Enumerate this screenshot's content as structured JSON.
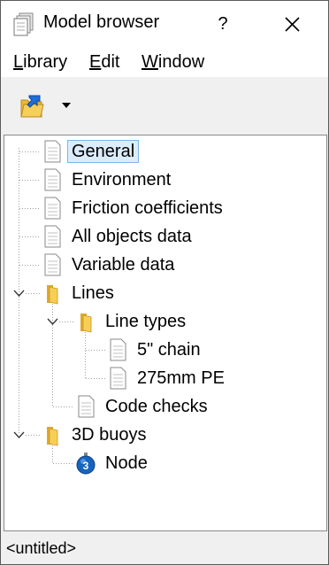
{
  "window": {
    "title": "Model browser",
    "help": "?"
  },
  "menu": [
    {
      "label": "Library",
      "accel": "L",
      "rest": "ibrary"
    },
    {
      "label": "Edit",
      "accel": "E",
      "rest": "dit"
    },
    {
      "label": "Window",
      "accel": "W",
      "rest": "indow"
    }
  ],
  "tree": {
    "items": [
      {
        "label": "General",
        "icon": "document-icon",
        "selected": true
      },
      {
        "label": "Environment",
        "icon": "document-icon"
      },
      {
        "label": "Friction coefficients",
        "icon": "document-icon"
      },
      {
        "label": "All objects data",
        "icon": "document-icon"
      },
      {
        "label": "Variable data",
        "icon": "document-icon"
      },
      {
        "label": "Lines",
        "icon": "folder-icon",
        "expanded": true
      },
      {
        "label": "Line types",
        "icon": "folder-icon",
        "expanded": true
      },
      {
        "label": "5\" chain",
        "icon": "document-icon"
      },
      {
        "label": "275mm PE",
        "icon": "document-icon"
      },
      {
        "label": "Code checks",
        "icon": "document-icon"
      },
      {
        "label": "3D buoys",
        "icon": "folder-icon",
        "expanded": true
      },
      {
        "label": "Node",
        "icon": "buoy-3d-icon",
        "badge": "3"
      }
    ]
  },
  "status": {
    "text": "<untitled>"
  },
  "colors": {
    "selection": "#dbecfb",
    "selection_border": "#7fb6e6",
    "folder": "#f5c542",
    "buoy": "#1565c0"
  }
}
